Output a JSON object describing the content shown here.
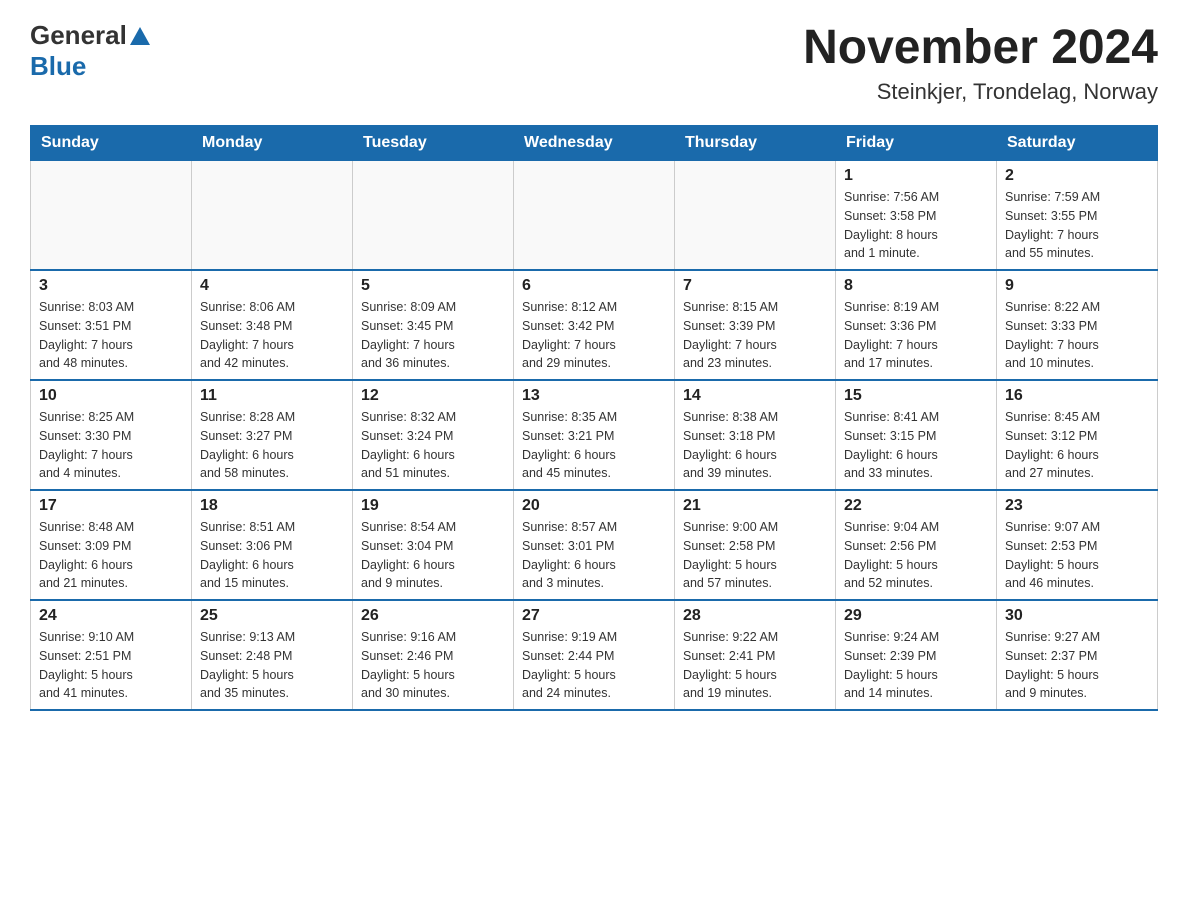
{
  "header": {
    "logo_general": "General",
    "logo_blue": "Blue",
    "month_title": "November 2024",
    "location": "Steinkjer, Trondelag, Norway"
  },
  "calendar": {
    "days_of_week": [
      "Sunday",
      "Monday",
      "Tuesday",
      "Wednesday",
      "Thursday",
      "Friday",
      "Saturday"
    ],
    "weeks": [
      [
        {
          "day": "",
          "info": ""
        },
        {
          "day": "",
          "info": ""
        },
        {
          "day": "",
          "info": ""
        },
        {
          "day": "",
          "info": ""
        },
        {
          "day": "",
          "info": ""
        },
        {
          "day": "1",
          "info": "Sunrise: 7:56 AM\nSunset: 3:58 PM\nDaylight: 8 hours\nand 1 minute."
        },
        {
          "day": "2",
          "info": "Sunrise: 7:59 AM\nSunset: 3:55 PM\nDaylight: 7 hours\nand 55 minutes."
        }
      ],
      [
        {
          "day": "3",
          "info": "Sunrise: 8:03 AM\nSunset: 3:51 PM\nDaylight: 7 hours\nand 48 minutes."
        },
        {
          "day": "4",
          "info": "Sunrise: 8:06 AM\nSunset: 3:48 PM\nDaylight: 7 hours\nand 42 minutes."
        },
        {
          "day": "5",
          "info": "Sunrise: 8:09 AM\nSunset: 3:45 PM\nDaylight: 7 hours\nand 36 minutes."
        },
        {
          "day": "6",
          "info": "Sunrise: 8:12 AM\nSunset: 3:42 PM\nDaylight: 7 hours\nand 29 minutes."
        },
        {
          "day": "7",
          "info": "Sunrise: 8:15 AM\nSunset: 3:39 PM\nDaylight: 7 hours\nand 23 minutes."
        },
        {
          "day": "8",
          "info": "Sunrise: 8:19 AM\nSunset: 3:36 PM\nDaylight: 7 hours\nand 17 minutes."
        },
        {
          "day": "9",
          "info": "Sunrise: 8:22 AM\nSunset: 3:33 PM\nDaylight: 7 hours\nand 10 minutes."
        }
      ],
      [
        {
          "day": "10",
          "info": "Sunrise: 8:25 AM\nSunset: 3:30 PM\nDaylight: 7 hours\nand 4 minutes."
        },
        {
          "day": "11",
          "info": "Sunrise: 8:28 AM\nSunset: 3:27 PM\nDaylight: 6 hours\nand 58 minutes."
        },
        {
          "day": "12",
          "info": "Sunrise: 8:32 AM\nSunset: 3:24 PM\nDaylight: 6 hours\nand 51 minutes."
        },
        {
          "day": "13",
          "info": "Sunrise: 8:35 AM\nSunset: 3:21 PM\nDaylight: 6 hours\nand 45 minutes."
        },
        {
          "day": "14",
          "info": "Sunrise: 8:38 AM\nSunset: 3:18 PM\nDaylight: 6 hours\nand 39 minutes."
        },
        {
          "day": "15",
          "info": "Sunrise: 8:41 AM\nSunset: 3:15 PM\nDaylight: 6 hours\nand 33 minutes."
        },
        {
          "day": "16",
          "info": "Sunrise: 8:45 AM\nSunset: 3:12 PM\nDaylight: 6 hours\nand 27 minutes."
        }
      ],
      [
        {
          "day": "17",
          "info": "Sunrise: 8:48 AM\nSunset: 3:09 PM\nDaylight: 6 hours\nand 21 minutes."
        },
        {
          "day": "18",
          "info": "Sunrise: 8:51 AM\nSunset: 3:06 PM\nDaylight: 6 hours\nand 15 minutes."
        },
        {
          "day": "19",
          "info": "Sunrise: 8:54 AM\nSunset: 3:04 PM\nDaylight: 6 hours\nand 9 minutes."
        },
        {
          "day": "20",
          "info": "Sunrise: 8:57 AM\nSunset: 3:01 PM\nDaylight: 6 hours\nand 3 minutes."
        },
        {
          "day": "21",
          "info": "Sunrise: 9:00 AM\nSunset: 2:58 PM\nDaylight: 5 hours\nand 57 minutes."
        },
        {
          "day": "22",
          "info": "Sunrise: 9:04 AM\nSunset: 2:56 PM\nDaylight: 5 hours\nand 52 minutes."
        },
        {
          "day": "23",
          "info": "Sunrise: 9:07 AM\nSunset: 2:53 PM\nDaylight: 5 hours\nand 46 minutes."
        }
      ],
      [
        {
          "day": "24",
          "info": "Sunrise: 9:10 AM\nSunset: 2:51 PM\nDaylight: 5 hours\nand 41 minutes."
        },
        {
          "day": "25",
          "info": "Sunrise: 9:13 AM\nSunset: 2:48 PM\nDaylight: 5 hours\nand 35 minutes."
        },
        {
          "day": "26",
          "info": "Sunrise: 9:16 AM\nSunset: 2:46 PM\nDaylight: 5 hours\nand 30 minutes."
        },
        {
          "day": "27",
          "info": "Sunrise: 9:19 AM\nSunset: 2:44 PM\nDaylight: 5 hours\nand 24 minutes."
        },
        {
          "day": "28",
          "info": "Sunrise: 9:22 AM\nSunset: 2:41 PM\nDaylight: 5 hours\nand 19 minutes."
        },
        {
          "day": "29",
          "info": "Sunrise: 9:24 AM\nSunset: 2:39 PM\nDaylight: 5 hours\nand 14 minutes."
        },
        {
          "day": "30",
          "info": "Sunrise: 9:27 AM\nSunset: 2:37 PM\nDaylight: 5 hours\nand 9 minutes."
        }
      ]
    ]
  }
}
